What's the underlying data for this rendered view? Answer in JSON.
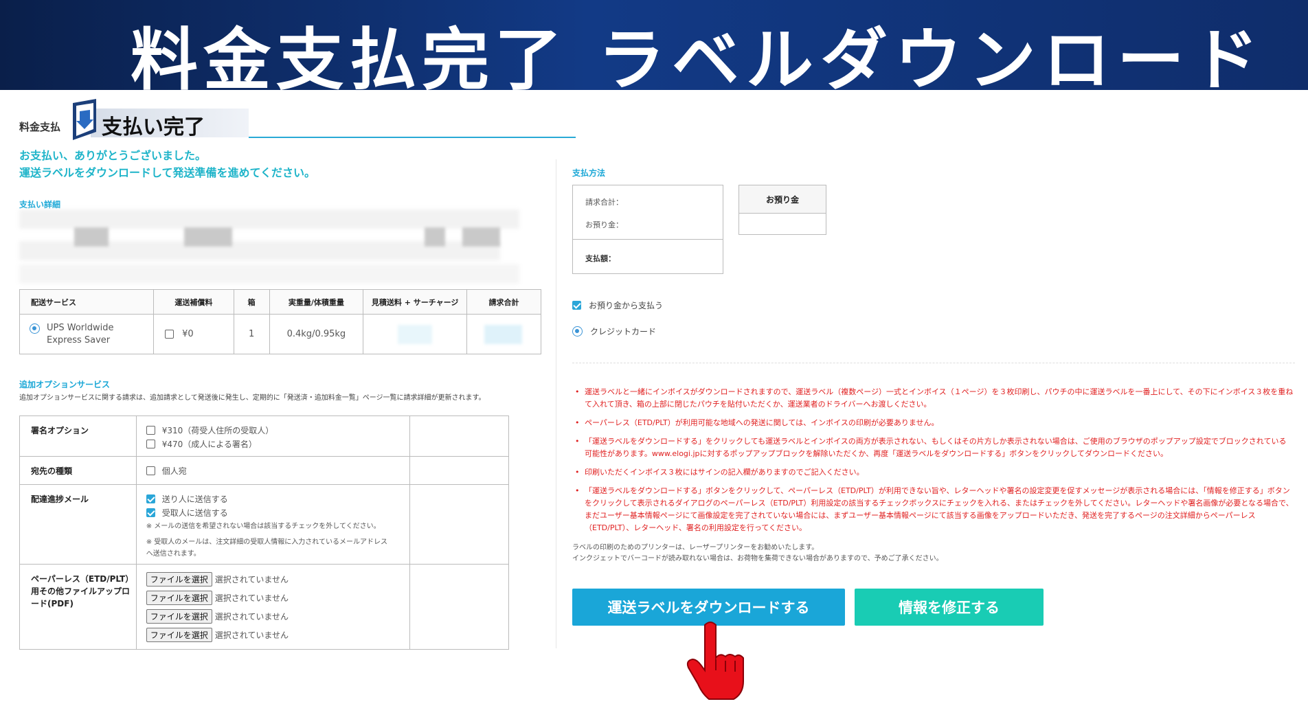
{
  "banner": {
    "title_left": "料金支払完了",
    "title_right": "ラベルダウンロード"
  },
  "step": {
    "label": "料金支払",
    "name": "支払い完了"
  },
  "thanks": {
    "line1": "お支払い、ありがとうございました。",
    "line2": "運送ラベルをダウンロードして発送準備を進めてください。"
  },
  "details": {
    "heading": "支払い詳細"
  },
  "shipping_table": {
    "headers": [
      "配送サービス",
      "運送補償料",
      "箱",
      "実重量/体積重量",
      "見積送料 + サーチャージ",
      "請求合計"
    ],
    "row": {
      "service": "UPS Worldwide Express Saver",
      "compensation": "¥0",
      "boxes": "1",
      "weight": "0.4kg/0.95kg"
    }
  },
  "options": {
    "heading": "追加オプションサービス",
    "description": "追加オプションサービスに関する請求は、追加請求として発送後に発生し、定期的に「発送済・追加料金一覧」ページ一覧に請求詳細が更新されます。",
    "signature": {
      "label": "署名オプション",
      "opt1": "¥310（荷受人住所の受取人）",
      "opt2": "¥470（成人による署名）"
    },
    "destination": {
      "label": "宛先の種類",
      "opt1": "個人宛"
    },
    "progress_mail": {
      "label": "配達進捗メール",
      "opt1": "送り人に送信する",
      "opt2": "受取人に送信する",
      "note1": "※ メールの送信を希望されない場合は該当するチェックを外してください。",
      "note2": "※ 受取人のメールは、注文詳細の受取人情報に入力されているメールアドレスへ送信されます。"
    },
    "paperless": {
      "label": "ペーパーレス（ETD/PLT）用その他ファイルアップロード(PDF)",
      "button": "ファイルを選択",
      "status": "選択されていません"
    }
  },
  "payment": {
    "heading": "支払方法",
    "total_label": "請求合計：",
    "deposit_label": "お預り金：",
    "pay_label": "支払額：",
    "deposit_box_title": "お預り金",
    "choice_deposit": "お預り金から支払う",
    "choice_card": "クレジットカード"
  },
  "warnings": [
    "運送ラベルと一緒にインボイスがダウンロードされますので、運送ラベル（複数ページ）一式とインボイス（１ページ）を３枚印刷し、パウチの中に運送ラベルを一番上にして、その下にインボイス３枚を重ねて入れて頂き、箱の上部に閉じたパウチを貼付いただくか、運送業者のドライバーへお渡しください。",
    "ペーパーレス（ETD/PLT）が利用可能な地域への発送に関しては、インボイスの印刷が必要ありません。",
    "「運送ラベルをダウンロードする」をクリックしても運送ラベルとインボイスの両方が表示されない、もしくはその片方しか表示されない場合は、ご使用のブラウザのポップアップ設定でブロックされている可能性があります。www.elogi.jpに対するポップアップブロックを解除いただくか、再度「運送ラベルをダウンロードする」ボタンをクリックしてダウンロードください。",
    "印刷いただくインボイス３枚にはサインの記入欄がありますのでご記入ください。",
    "「運送ラベルをダウンロードする」ボタンをクリックして、ペーパーレス（ETD/PLT）が利用できない旨や、レターヘッドや署名の設定変更を促すメッセージが表示される場合には、「情報を修正する」ボタンをクリックして表示されるダイアログのペーパーレス（ETD/PLT）利用設定の該当するチェックボックスにチェックを入れる、またはチェックを外してください。レターヘッドや署名画像が必要となる場合で、まだユーザー基本情報ページにて画像設定を完了されていない場合には、まずユーザー基本情報ページにて該当する画像をアップロードいただき、発送を完了するページの注文詳細からペーパーレス（ETD/PLT）、レターヘッド、署名の利用設定を行ってください。"
  ],
  "printer_note": {
    "line1": "ラベルの印刷のためのプリンターは、レーザープリンターをお勧めいたします。",
    "line2": "インクジェットでバーコードが読み取れない場合は、お荷物を集荷できない場合がありますので、予めご了承ください。"
  },
  "buttons": {
    "download": "運送ラベルをダウンロードする",
    "edit": "情報を修正する"
  },
  "colors": {
    "banner": "#123a86",
    "accent": "#1aa6d8",
    "teal": "#19ccb4",
    "warning": "#e02020"
  }
}
